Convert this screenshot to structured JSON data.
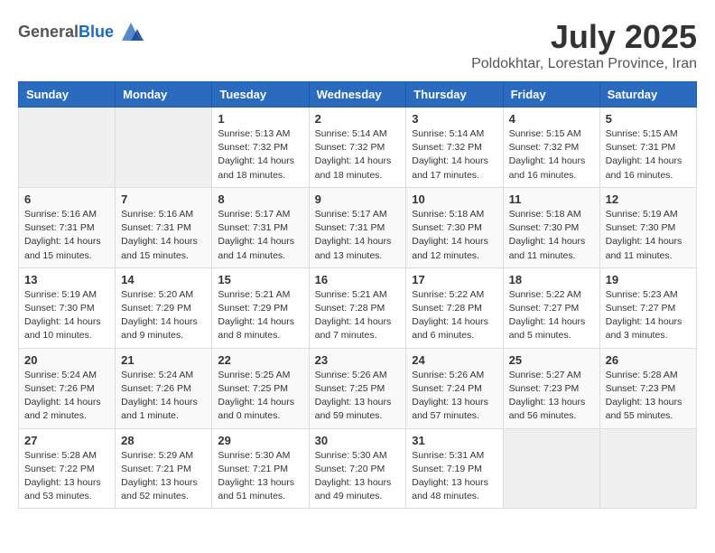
{
  "header": {
    "logo_general": "General",
    "logo_blue": "Blue",
    "month_title": "July 2025",
    "location": "Poldokhtar, Lorestan Province, Iran"
  },
  "weekdays": [
    "Sunday",
    "Monday",
    "Tuesday",
    "Wednesday",
    "Thursday",
    "Friday",
    "Saturday"
  ],
  "weeks": [
    [
      {
        "day": "",
        "info": ""
      },
      {
        "day": "",
        "info": ""
      },
      {
        "day": "1",
        "info": "Sunrise: 5:13 AM\nSunset: 7:32 PM\nDaylight: 14 hours and 18 minutes."
      },
      {
        "day": "2",
        "info": "Sunrise: 5:14 AM\nSunset: 7:32 PM\nDaylight: 14 hours and 18 minutes."
      },
      {
        "day": "3",
        "info": "Sunrise: 5:14 AM\nSunset: 7:32 PM\nDaylight: 14 hours and 17 minutes."
      },
      {
        "day": "4",
        "info": "Sunrise: 5:15 AM\nSunset: 7:32 PM\nDaylight: 14 hours and 16 minutes."
      },
      {
        "day": "5",
        "info": "Sunrise: 5:15 AM\nSunset: 7:31 PM\nDaylight: 14 hours and 16 minutes."
      }
    ],
    [
      {
        "day": "6",
        "info": "Sunrise: 5:16 AM\nSunset: 7:31 PM\nDaylight: 14 hours and 15 minutes."
      },
      {
        "day": "7",
        "info": "Sunrise: 5:16 AM\nSunset: 7:31 PM\nDaylight: 14 hours and 15 minutes."
      },
      {
        "day": "8",
        "info": "Sunrise: 5:17 AM\nSunset: 7:31 PM\nDaylight: 14 hours and 14 minutes."
      },
      {
        "day": "9",
        "info": "Sunrise: 5:17 AM\nSunset: 7:31 PM\nDaylight: 14 hours and 13 minutes."
      },
      {
        "day": "10",
        "info": "Sunrise: 5:18 AM\nSunset: 7:30 PM\nDaylight: 14 hours and 12 minutes."
      },
      {
        "day": "11",
        "info": "Sunrise: 5:18 AM\nSunset: 7:30 PM\nDaylight: 14 hours and 11 minutes."
      },
      {
        "day": "12",
        "info": "Sunrise: 5:19 AM\nSunset: 7:30 PM\nDaylight: 14 hours and 11 minutes."
      }
    ],
    [
      {
        "day": "13",
        "info": "Sunrise: 5:19 AM\nSunset: 7:30 PM\nDaylight: 14 hours and 10 minutes."
      },
      {
        "day": "14",
        "info": "Sunrise: 5:20 AM\nSunset: 7:29 PM\nDaylight: 14 hours and 9 minutes."
      },
      {
        "day": "15",
        "info": "Sunrise: 5:21 AM\nSunset: 7:29 PM\nDaylight: 14 hours and 8 minutes."
      },
      {
        "day": "16",
        "info": "Sunrise: 5:21 AM\nSunset: 7:28 PM\nDaylight: 14 hours and 7 minutes."
      },
      {
        "day": "17",
        "info": "Sunrise: 5:22 AM\nSunset: 7:28 PM\nDaylight: 14 hours and 6 minutes."
      },
      {
        "day": "18",
        "info": "Sunrise: 5:22 AM\nSunset: 7:27 PM\nDaylight: 14 hours and 5 minutes."
      },
      {
        "day": "19",
        "info": "Sunrise: 5:23 AM\nSunset: 7:27 PM\nDaylight: 14 hours and 3 minutes."
      }
    ],
    [
      {
        "day": "20",
        "info": "Sunrise: 5:24 AM\nSunset: 7:26 PM\nDaylight: 14 hours and 2 minutes."
      },
      {
        "day": "21",
        "info": "Sunrise: 5:24 AM\nSunset: 7:26 PM\nDaylight: 14 hours and 1 minute."
      },
      {
        "day": "22",
        "info": "Sunrise: 5:25 AM\nSunset: 7:25 PM\nDaylight: 14 hours and 0 minutes."
      },
      {
        "day": "23",
        "info": "Sunrise: 5:26 AM\nSunset: 7:25 PM\nDaylight: 13 hours and 59 minutes."
      },
      {
        "day": "24",
        "info": "Sunrise: 5:26 AM\nSunset: 7:24 PM\nDaylight: 13 hours and 57 minutes."
      },
      {
        "day": "25",
        "info": "Sunrise: 5:27 AM\nSunset: 7:23 PM\nDaylight: 13 hours and 56 minutes."
      },
      {
        "day": "26",
        "info": "Sunrise: 5:28 AM\nSunset: 7:23 PM\nDaylight: 13 hours and 55 minutes."
      }
    ],
    [
      {
        "day": "27",
        "info": "Sunrise: 5:28 AM\nSunset: 7:22 PM\nDaylight: 13 hours and 53 minutes."
      },
      {
        "day": "28",
        "info": "Sunrise: 5:29 AM\nSunset: 7:21 PM\nDaylight: 13 hours and 52 minutes."
      },
      {
        "day": "29",
        "info": "Sunrise: 5:30 AM\nSunset: 7:21 PM\nDaylight: 13 hours and 51 minutes."
      },
      {
        "day": "30",
        "info": "Sunrise: 5:30 AM\nSunset: 7:20 PM\nDaylight: 13 hours and 49 minutes."
      },
      {
        "day": "31",
        "info": "Sunrise: 5:31 AM\nSunset: 7:19 PM\nDaylight: 13 hours and 48 minutes."
      },
      {
        "day": "",
        "info": ""
      },
      {
        "day": "",
        "info": ""
      }
    ]
  ]
}
